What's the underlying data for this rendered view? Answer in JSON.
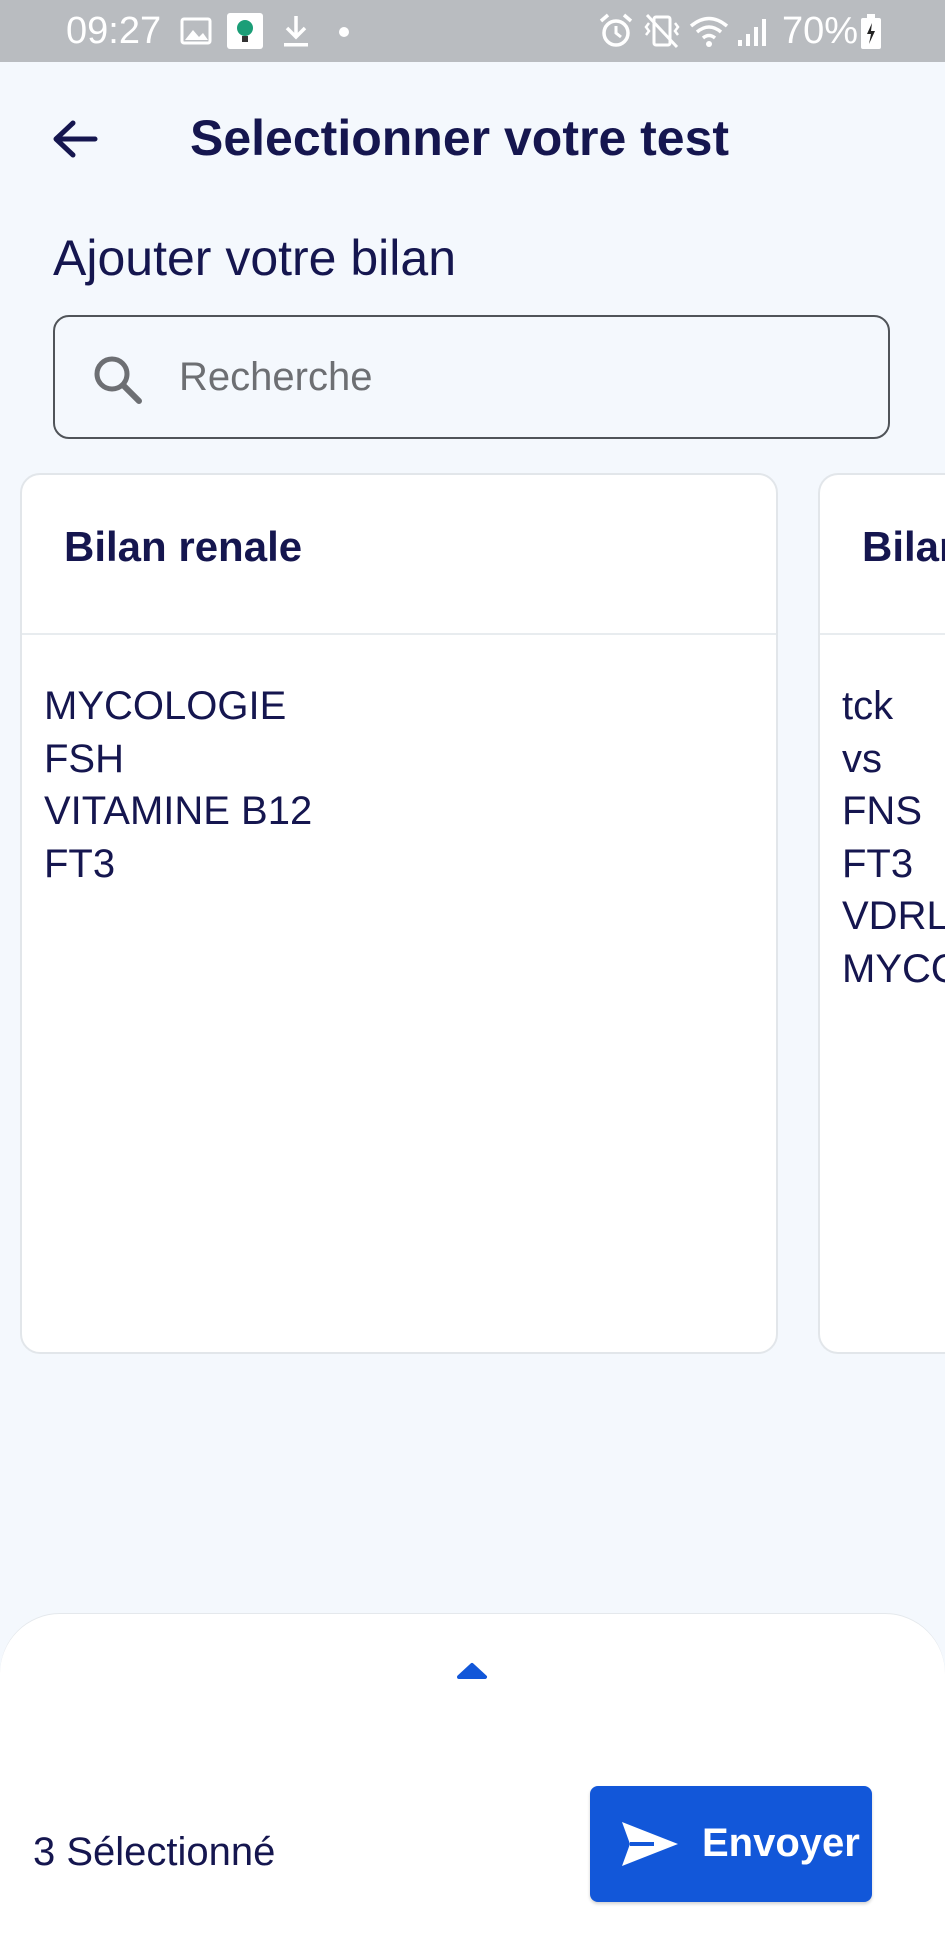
{
  "status_bar": {
    "time": "09:27",
    "battery": "70%",
    "icons": [
      "image-icon",
      "notification-app-icon",
      "download-icon",
      "dot-icon",
      "alarm-icon",
      "vibrate-icon",
      "wifi-icon",
      "signal-icon",
      "battery-icon"
    ]
  },
  "header": {
    "title": "Selectionner votre test",
    "back_icon": "arrow-left-icon"
  },
  "section": {
    "title": "Ajouter votre bilan"
  },
  "search": {
    "placeholder": "Recherche",
    "value": "",
    "icon": "search-icon"
  },
  "cards": [
    {
      "title": "Bilan renale",
      "items": [
        "MYCOLOGIE",
        "FSH",
        "VITAMINE B12",
        "FT3"
      ]
    },
    {
      "title": "Bilan",
      "items": [
        "tck",
        "vs",
        "FNS",
        "FT3",
        "VDRL",
        "MYCO"
      ]
    }
  ],
  "bottom_sheet": {
    "handle_icon": "chevron-up-icon",
    "selected_count": "3 Sélectionné",
    "send_label": "Envoyer",
    "send_icon": "send-icon"
  },
  "colors": {
    "background": "#f4f8fd",
    "status_bar": "#b9bcc0",
    "text_primary": "#15164f",
    "accent": "#1257d9",
    "card": "#ffffff"
  }
}
